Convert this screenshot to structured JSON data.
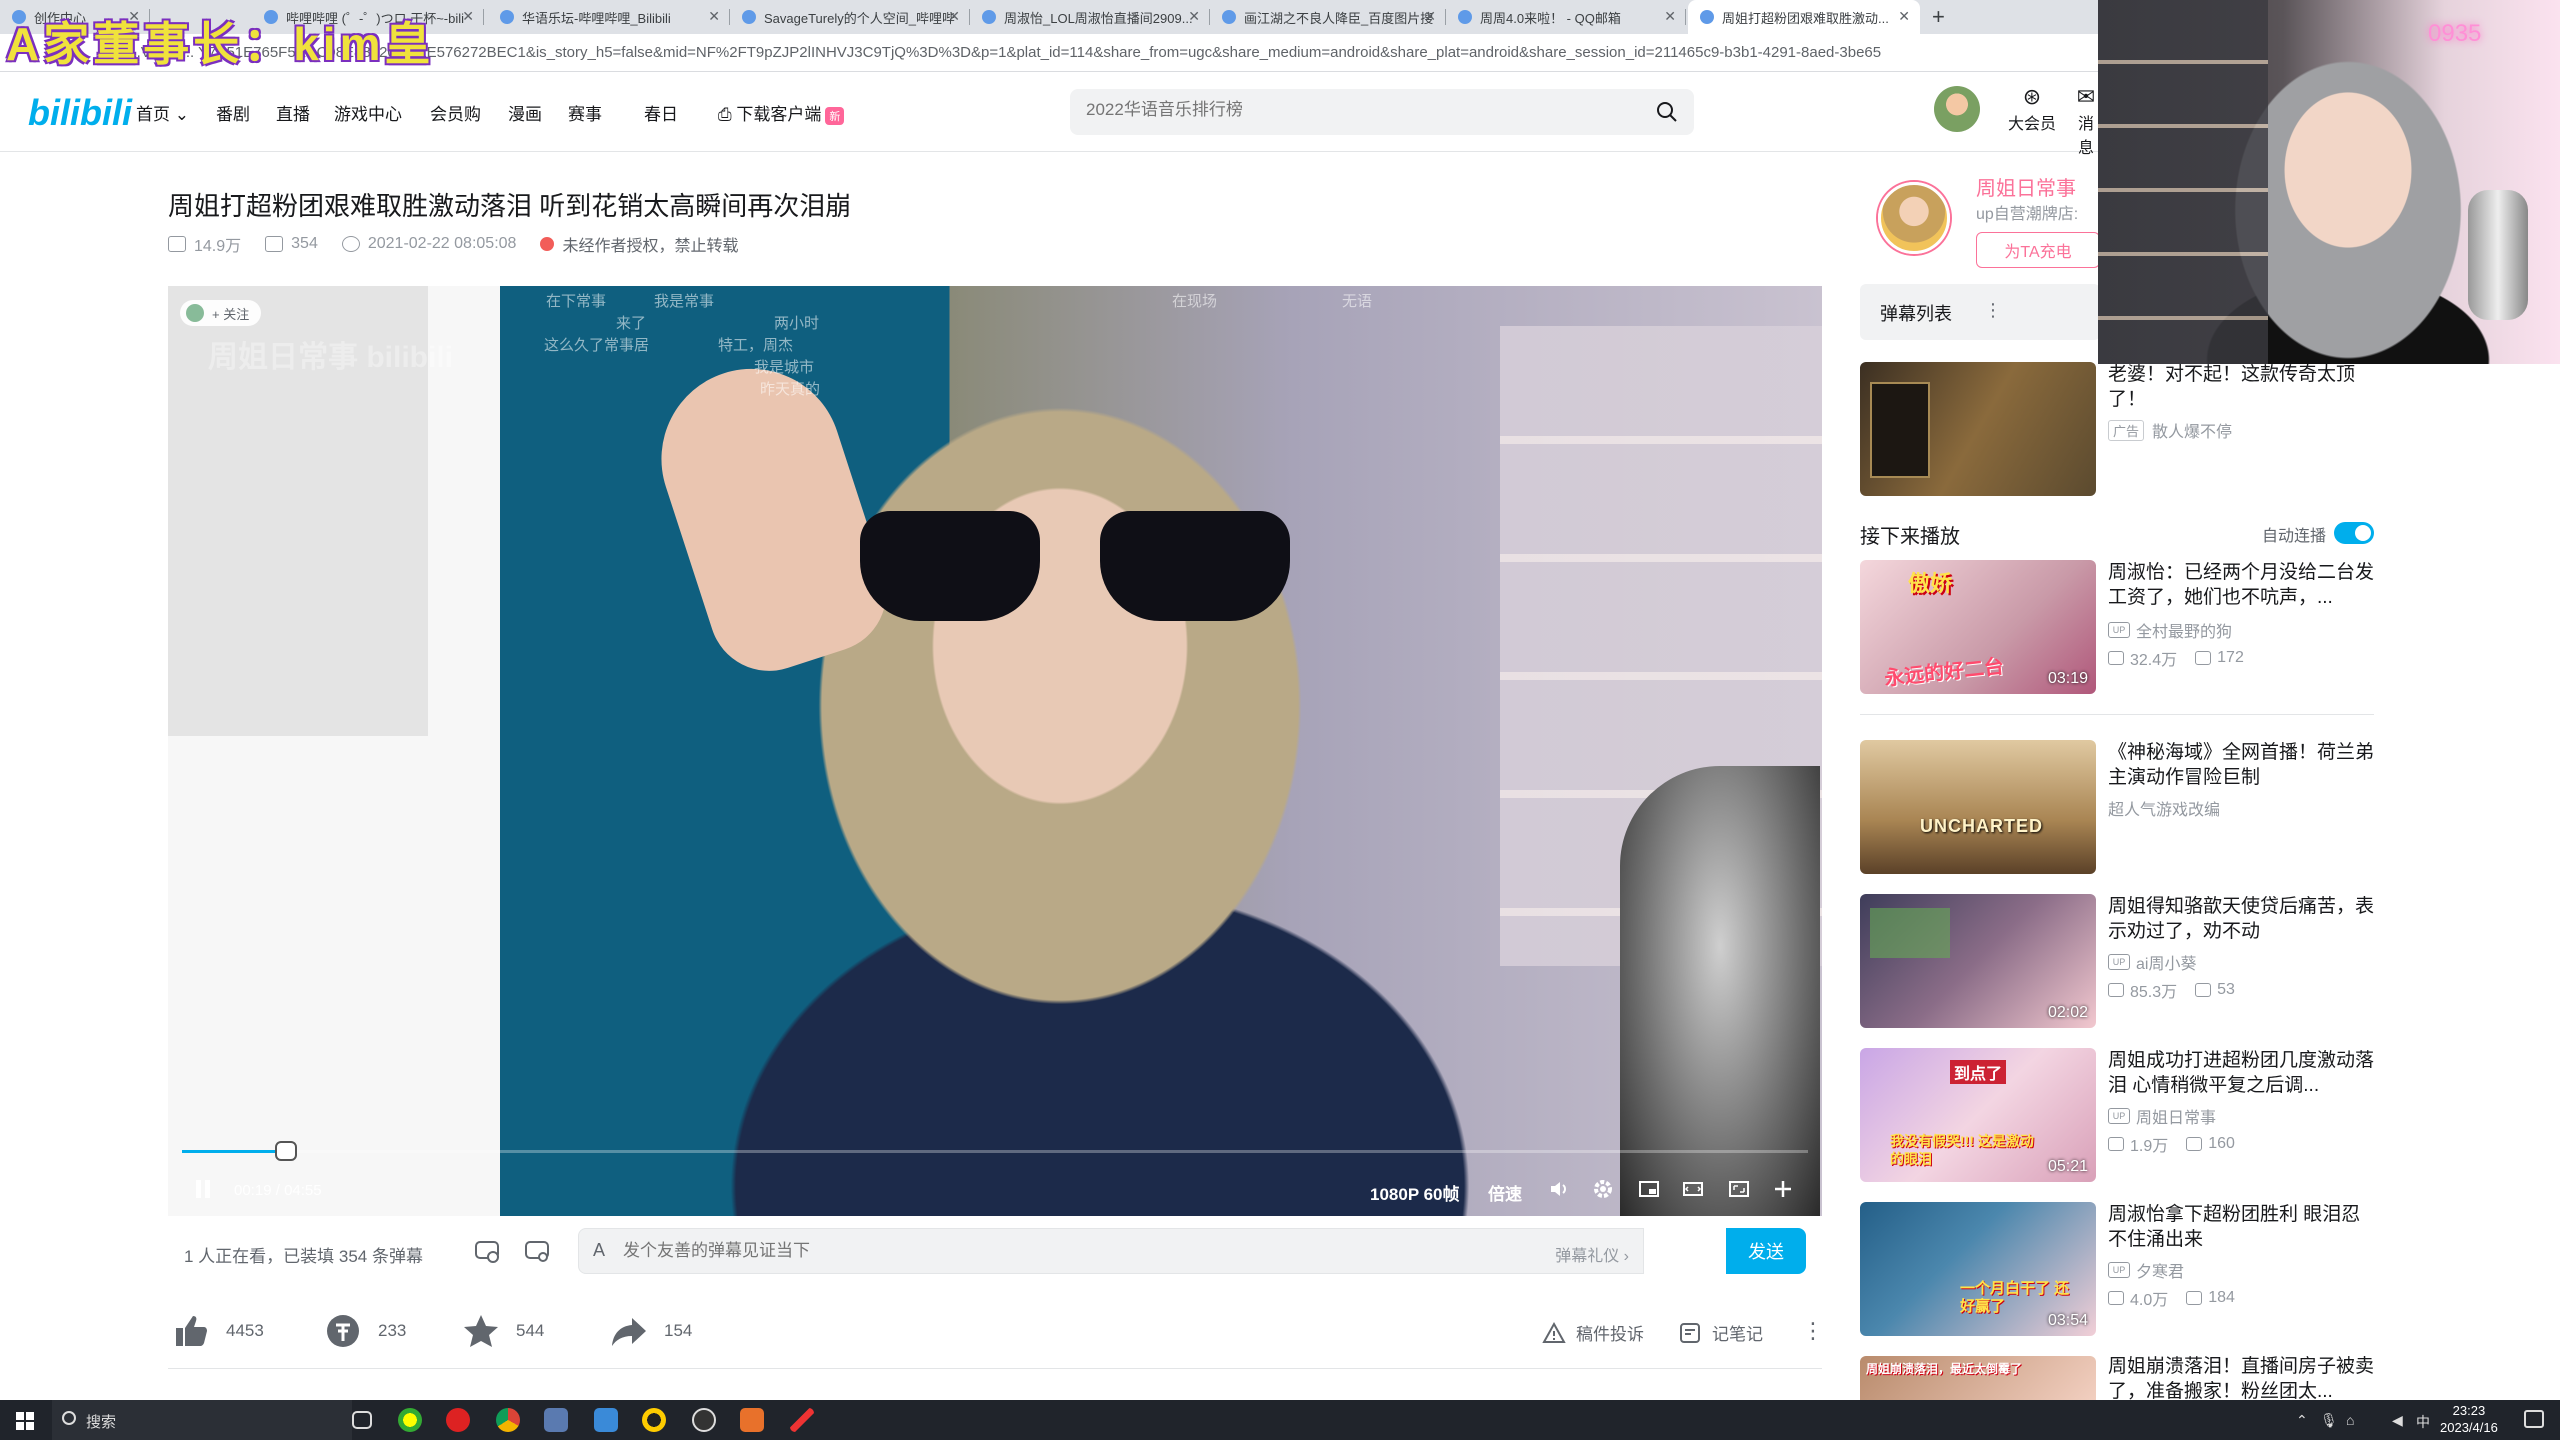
{
  "overlay": {
    "title": "A家董事长：kim皇"
  },
  "browser": {
    "tabs": [
      {
        "label": "创作中心"
      },
      {
        "label": "哔哩哔哩 (゜-゜)つロ 干杯~-bili"
      },
      {
        "label": "华语乐坛-哔哩哔哩_Bilibili"
      },
      {
        "label": "SavageTurely的个人空间_哔哩哔"
      },
      {
        "label": "周淑怡_LOL周淑怡直播间2909..."
      },
      {
        "label": "画江湖之不良人降臣_百度图片搜"
      },
      {
        "label": "周周4.0来啦！ - QQ邮箱"
      },
      {
        "label": "周姐打超粉团艰难取胜激动..."
      }
    ],
    "url": "b...V1Ph ... Y7E51E765F5ADC98E88120ADEE576272BEC1&is_story_h5=false&mid=NF%2FT9pZJP2lINHVJ3C9TjQ%3D%3D&p=1&plat_id=114&share_from=ugc&share_medium=android&share_plat=android&share_session_id=211465c9-b3b1-4291-8aed-3be65"
  },
  "header": {
    "logo": "bilibili",
    "nav": [
      "首页",
      "番剧",
      "直播",
      "游戏中心",
      "会员购",
      "漫画",
      "赛事",
      "春日",
      "下载客户端"
    ],
    "new_badge": "新",
    "search_placeholder": "2022华语音乐排行榜",
    "vip_label": "大会员",
    "msg_label": "消息"
  },
  "video": {
    "title": "周姐打超粉团艰难取胜激动落泪 听到花销太高瞬间再次泪崩",
    "views": "14.9万",
    "danmaku_count": "354",
    "date": "2021-02-22 08:05:08",
    "notice": "未经作者授权，禁止转载",
    "follow": "+ 关注",
    "watermark": "周姐日常事  bilibili",
    "danmaku": [
      "在下常事",
      "我是常事",
      "来了",
      "两小时",
      "这么久了常事居",
      "特工，周杰",
      "我是城市",
      "昨天真的",
      "在现场",
      "无语"
    ],
    "time_current": "00:19",
    "time_total": "04:55",
    "progress": 0.064,
    "quality": "1080P 60帧",
    "speed": "倍速"
  },
  "sendbar": {
    "viewers": "1 人正在看，已装填 354 条弹幕",
    "placeholder": "发个友善的弹幕见证当下",
    "etiquette": "弹幕礼仪 ›",
    "send": "发送"
  },
  "actions": {
    "likes": "4453",
    "coins": "233",
    "favorites": "544",
    "shares": "154",
    "report": "稿件投诉",
    "notes": "记笔记"
  },
  "sidebar": {
    "up_name": "周姐日常事",
    "up_desc": "up自营潮牌店:",
    "charge": "为TA充电",
    "danmaku_list": "弹幕列表",
    "danmaku_more": "⋮",
    "ad": {
      "title": "老婆！对不起！这款传奇太顶了！",
      "badge": "广告",
      "author": "散人爆不停"
    },
    "next_label": "接下来播放",
    "autoplay": "自动连播",
    "cards": [
      {
        "title": "周淑怡：已经两个月没给二台发工资了，她们也不吭声，...",
        "up": "全村最野的狗",
        "views": "32.4万",
        "dm": "172",
        "duration": "03:19"
      },
      {
        "title": "《神秘海域》全网首播！荷兰弟主演动作冒险巨制",
        "up": "超人气游戏改编",
        "views": "",
        "dm": "",
        "duration": ""
      },
      {
        "title": "周姐得知骆歆天使贷后痛苦，表示劝过了，劝不动",
        "up": "ai周小葵",
        "views": "85.3万",
        "dm": "53",
        "duration": "02:02"
      },
      {
        "title": "周姐成功打进超粉团几度激动落泪 心情稍微平复之后调...",
        "up": "周姐日常事",
        "views": "1.9万",
        "dm": "160",
        "duration": "05:21"
      },
      {
        "title": "周淑怡拿下超粉团胜利 眼泪忍不住涌出来",
        "up": "夕寒君",
        "views": "4.0万",
        "dm": "184",
        "duration": "03:54"
      },
      {
        "title": "周姐崩溃落泪！直播间房子被卖了，准备搬家！粉丝团太...",
        "up": "",
        "views": "",
        "dm": "",
        "duration": ""
      }
    ],
    "thumb_texts": [
      "傲娇",
      "永远的好二台",
      "UNCHARTED",
      "到点了",
      "我没有假哭!!! 这是激动的眼泪",
      "一个月白干了 还好赢了",
      "周姐崩溃落泪，最近太倒霉了"
    ]
  },
  "webcam": {
    "sign": "0935"
  },
  "taskbar": {
    "search": "搜索",
    "time": "23:23",
    "date": "2023/4/16",
    "ime": "中"
  }
}
